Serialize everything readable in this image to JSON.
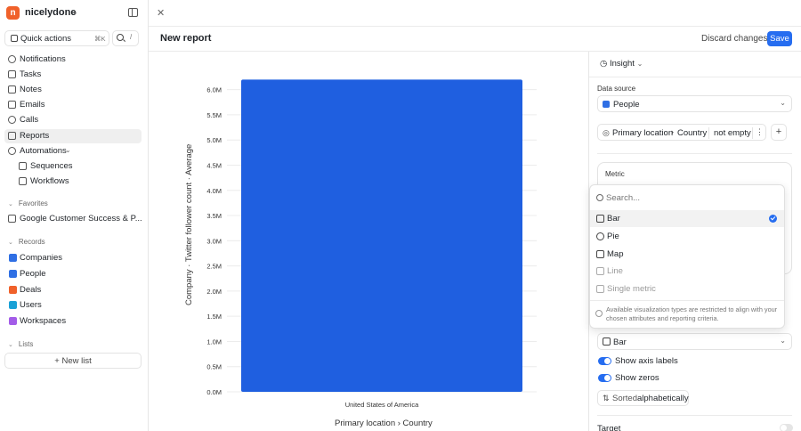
{
  "workspace": {
    "name": "nicelydone",
    "logo_letter": "n"
  },
  "sidebar": {
    "quick_actions": {
      "label": "Quick actions",
      "shortcut": "⌘K"
    },
    "search_shortcut": "/",
    "nav": [
      {
        "label": "Notifications",
        "icon": "bell-icon"
      },
      {
        "label": "Tasks",
        "icon": "check-square-icon"
      },
      {
        "label": "Notes",
        "icon": "note-icon"
      },
      {
        "label": "Emails",
        "icon": "mail-icon"
      },
      {
        "label": "Calls",
        "icon": "phone-icon"
      },
      {
        "label": "Reports",
        "icon": "report-icon",
        "active": true
      },
      {
        "label": "Automations",
        "icon": "play-icon"
      }
    ],
    "automations_children": [
      {
        "label": "Sequences",
        "icon": "send-icon"
      },
      {
        "label": "Workflows",
        "icon": "workflow-icon"
      }
    ],
    "favorites_header": "Favorites",
    "favorites": [
      {
        "label": "Google Customer Success & P..."
      }
    ],
    "records_header": "Records",
    "records": [
      {
        "label": "Companies",
        "color": "#2f6fe4"
      },
      {
        "label": "People",
        "color": "#2f6fe4"
      },
      {
        "label": "Deals",
        "color": "#f0612a"
      },
      {
        "label": "Users",
        "color": "#1aa1d6"
      },
      {
        "label": "Workspaces",
        "color": "#a35ce8"
      }
    ],
    "lists_header": "Lists",
    "new_list": "+ New list"
  },
  "header": {
    "title": "New report",
    "discard": "Discard changes",
    "save": "Save"
  },
  "chart_data": {
    "type": "bar",
    "categories": [
      "United States of America"
    ],
    "values": [
      6.2
    ],
    "unit": "M",
    "ylim": [
      0,
      6.4
    ],
    "yticks": [
      "0.0M",
      "0.5M",
      "1.0M",
      "1.5M",
      "2.0M",
      "2.5M",
      "3.0M",
      "3.5M",
      "4.0M",
      "4.5M",
      "5.0M",
      "5.5M",
      "6.0M"
    ],
    "ylabel": "Company · Twitter follower count · Average",
    "xlabel": "Primary location › Country",
    "bar_color": "#1f5fe0"
  },
  "panel": {
    "insight_label": "Insight",
    "data_source_label": "Data source",
    "data_source_value": "People",
    "filter": {
      "attribute": "Primary location",
      "sub": "Country",
      "condition": "not empty"
    },
    "metric_label": "Metric",
    "viz_value": "Bar",
    "show_axis_labels": "Show axis labels",
    "show_zeros": "Show zeros",
    "sorted_prefix": "Sorted",
    "sorted_value": "alphabetically",
    "target_label": "Target"
  },
  "dropdown": {
    "search_placeholder": "Search...",
    "items": [
      {
        "label": "Bar",
        "selected": true,
        "disabled": false
      },
      {
        "label": "Pie",
        "selected": false,
        "disabled": false
      },
      {
        "label": "Map",
        "selected": false,
        "disabled": false
      },
      {
        "label": "Line",
        "selected": false,
        "disabled": true
      },
      {
        "label": "Single metric",
        "selected": false,
        "disabled": true
      }
    ],
    "note": "Available visualization types are restricted to align with your chosen attributes and reporting criteria."
  }
}
